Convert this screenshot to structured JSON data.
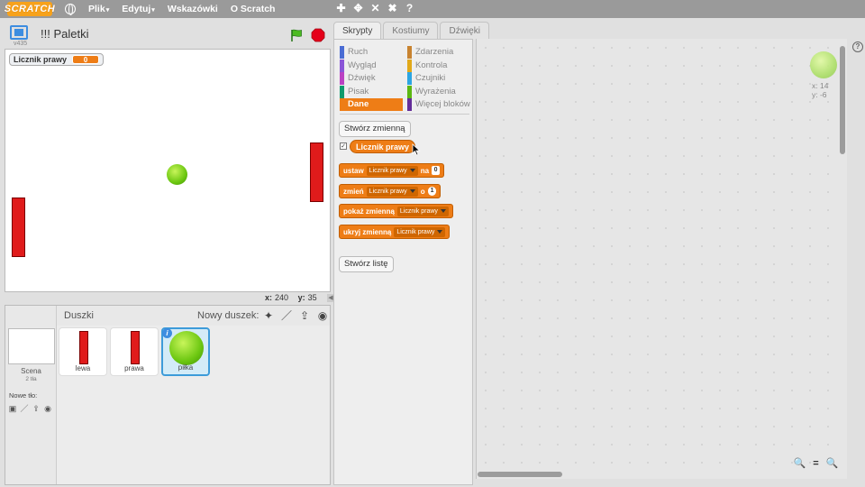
{
  "menubar": {
    "logo": "SCRATCH",
    "items": [
      {
        "label": "Plik",
        "caret": "▾"
      },
      {
        "label": "Edytuj",
        "caret": "▾"
      },
      {
        "label": "Wskazówki",
        "caret": ""
      },
      {
        "label": "O Scratch",
        "caret": ""
      }
    ],
    "tools": [
      "✚",
      "✥",
      "✕",
      "✖",
      "?"
    ]
  },
  "stage_header": {
    "version": "v435",
    "title": "!!! Paletki"
  },
  "stage": {
    "monitor": {
      "label": "Licznik prawy",
      "value": "0"
    },
    "coords": {
      "x_label": "x:",
      "x": "240",
      "y_label": "y:",
      "y": "35"
    }
  },
  "sprites": {
    "title": "Duszki",
    "new_sprite_label": "Nowy duszek:",
    "new_sprite_icons": [
      "✦",
      "／",
      "⇪",
      "◉"
    ],
    "stage_label": "Scena",
    "stage_sub": "2 tła",
    "new_bg_label": "Nowe tło:",
    "new_bg_icons": [
      "▣",
      "／",
      "⇪",
      "◉"
    ],
    "items": [
      {
        "name": "lewa"
      },
      {
        "name": "prawa"
      },
      {
        "name": "piłka",
        "info": "i"
      }
    ]
  },
  "tabs": [
    {
      "label": "Skrypty"
    },
    {
      "label": "Kostiumy"
    },
    {
      "label": "Dźwięki"
    }
  ],
  "categories": [
    {
      "label": "Ruch",
      "color": "#4a6cd4"
    },
    {
      "label": "Zdarzenia",
      "color": "#c88330"
    },
    {
      "label": "Wygląd",
      "color": "#8a55d7"
    },
    {
      "label": "Kontrola",
      "color": "#e1a91a"
    },
    {
      "label": "Dźwięk",
      "color": "#bb42c3"
    },
    {
      "label": "Czujniki",
      "color": "#2ca5e2"
    },
    {
      "label": "Pisak",
      "color": "#0e9a6c"
    },
    {
      "label": "Wyrażenia",
      "color": "#5cb712"
    },
    {
      "label": "Dane",
      "color": "#ee7d16"
    },
    {
      "label": "Więcej bloków",
      "color": "#632d99"
    }
  ],
  "palette": {
    "make_variable": "Stwórz zmienną",
    "variable_reporter": "Licznik prawy",
    "checkbox": "✓",
    "blocks": {
      "set": {
        "word": "ustaw",
        "var": "Licznik prawy",
        "to": "na",
        "value": "0"
      },
      "change": {
        "word": "zmień",
        "var": "Licznik prawy",
        "by": "o",
        "value": "1"
      },
      "show": {
        "word": "pokaż zmienną",
        "var": "Licznik prawy"
      },
      "hide": {
        "word": "ukryj zmienną",
        "var": "Licznik prawy"
      }
    },
    "make_list": "Stwórz listę"
  },
  "script_area": {
    "sprite_x": "x: 14",
    "sprite_y": "y: -6",
    "zoom": [
      "🔍",
      "=",
      "🔍"
    ]
  },
  "colors": {
    "data_orange": "#ee7d16",
    "paddle_red": "#e01b1b",
    "ball_green": "#6cc711",
    "selection_blue": "#3d9bd9"
  }
}
